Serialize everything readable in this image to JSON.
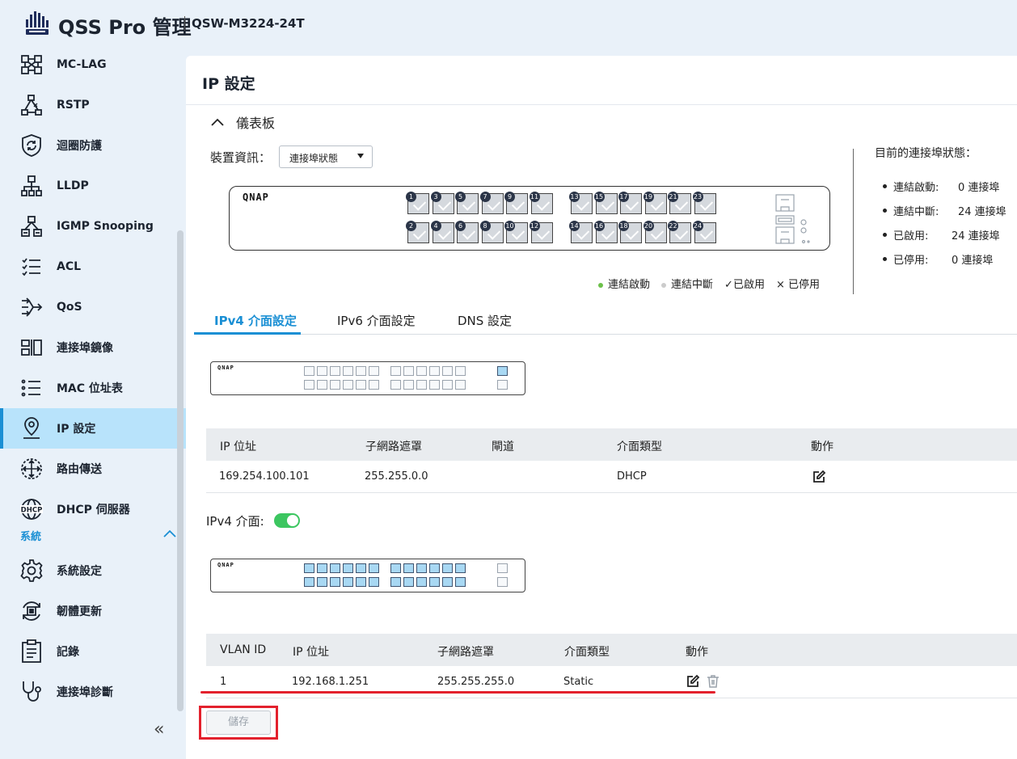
{
  "header": {
    "title": "QSS Pro 管理",
    "model": "QSW-M3224-24T"
  },
  "sidebar": {
    "items": [
      {
        "label": "MC-LAG",
        "icon": "mclag-icon"
      },
      {
        "label": "RSTP",
        "icon": "rstp-icon"
      },
      {
        "label": "迴圈防護",
        "icon": "loop-protection-icon"
      },
      {
        "label": "LLDP",
        "icon": "lldp-icon"
      },
      {
        "label": "IGMP  Snooping",
        "icon": "igmp-icon"
      },
      {
        "label": "ACL",
        "icon": "acl-icon"
      },
      {
        "label": "QoS",
        "icon": "qos-icon"
      },
      {
        "label": "連接埠鏡像",
        "icon": "port-mirror-icon"
      },
      {
        "label": "MAC  位址表",
        "icon": "mac-table-icon"
      },
      {
        "label": "IP  設定",
        "icon": "ip-settings-icon",
        "active": true
      },
      {
        "label": "路由傳送",
        "icon": "routing-icon"
      },
      {
        "label": "DHCP  伺服器",
        "icon": "dhcp-icon",
        "icon_text": "DHCP"
      }
    ],
    "group_label": "系統",
    "system_items": [
      {
        "label": "系統設定",
        "icon": "gear-icon"
      },
      {
        "label": "韌體更新",
        "icon": "firmware-icon"
      },
      {
        "label": "記錄",
        "icon": "log-icon"
      },
      {
        "label": "連接埠診斷",
        "icon": "stethoscope-icon"
      }
    ],
    "collapse_glyph": "«"
  },
  "page": {
    "title": "IP  設定",
    "dashboard": {
      "toggle_label": "儀表板",
      "device_info_label": "裝置資訊：",
      "device_select_value": "連接埠狀態",
      "brand": "QNAP",
      "ports_top": [
        "1",
        "3",
        "5",
        "7",
        "9",
        "11",
        "13",
        "15",
        "17",
        "19",
        "21",
        "23"
      ],
      "ports_bottom": [
        "2",
        "4",
        "6",
        "8",
        "10",
        "12",
        "14",
        "16",
        "18",
        "20",
        "22",
        "24"
      ],
      "legend": [
        {
          "label": "連結啟動",
          "mark": "•",
          "color": "#6cc04a"
        },
        {
          "label": "連結中斷",
          "mark": "•",
          "color": "#cccccc"
        },
        {
          "label": "已啟用",
          "mark": "✓",
          "color": "#222222"
        },
        {
          "label": "已停用",
          "mark": "×",
          "color": "#222222"
        }
      ],
      "status_title": "目前的連接埠狀態：",
      "status": [
        {
          "label": "連結啟動:",
          "value": "0 連接埠"
        },
        {
          "label": "連結中斷:",
          "value": "24 連接埠"
        },
        {
          "label": "已啟用:",
          "value": "24 連接埠"
        },
        {
          "label": "已停用:",
          "value": "0 連接埠"
        }
      ]
    },
    "tabs": [
      {
        "label": "IPv4 介面設定",
        "active": true
      },
      {
        "label": "IPv6 介面設定"
      },
      {
        "label": "DNS 設定"
      }
    ],
    "mgmt_table": {
      "headers": [
        "IP  位址",
        "子網路遮罩",
        "閘道",
        "介面類型",
        "動作"
      ],
      "rows": [
        {
          "ip": "169.254.100.101",
          "mask": "255.255.0.0",
          "gateway": "",
          "type": "DHCP"
        }
      ]
    },
    "ipv4_toggle_label": "IPv4  介面:",
    "ipv4_enabled": true,
    "vlan_table": {
      "headers": [
        "VLAN  ID",
        "IP  位址",
        "子網路遮罩",
        "介面類型",
        "動作"
      ],
      "rows": [
        {
          "vlan": "1",
          "ip": "192.168.1.251",
          "mask": "255.255.255.0",
          "type": "Static"
        }
      ]
    },
    "save_label": "儲存"
  }
}
